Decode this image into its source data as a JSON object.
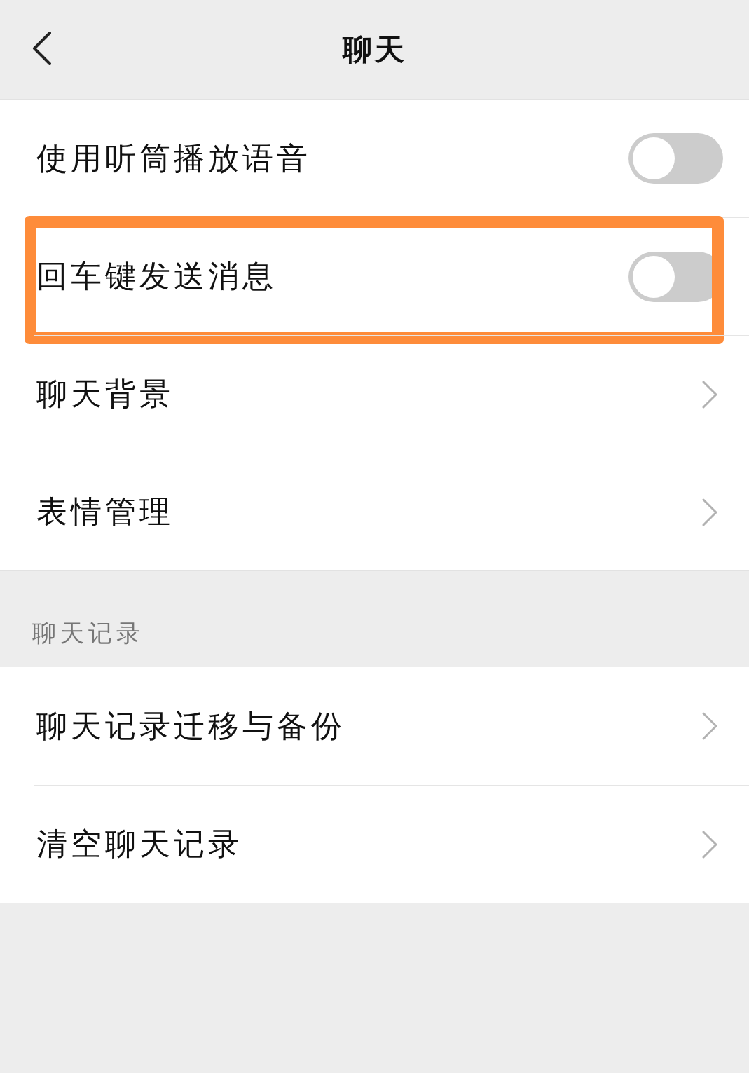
{
  "nav_bar": {
    "title": "聊天"
  },
  "groups": [
    {
      "items": [
        {
          "kind": "toggle",
          "label": "使用听筒播放语音",
          "on": false,
          "highlighted": false
        },
        {
          "kind": "toggle",
          "label": "回车键发送消息",
          "on": false,
          "highlighted": true
        },
        {
          "kind": "link",
          "label": "聊天背景",
          "highlighted": false
        },
        {
          "kind": "link",
          "label": "表情管理",
          "highlighted": false
        }
      ]
    },
    {
      "title": "聊天记录",
      "items": [
        {
          "kind": "link",
          "label": "聊天记录迁移与备份",
          "highlighted": false
        },
        {
          "kind": "link",
          "label": "清空聊天记录",
          "highlighted": false
        }
      ]
    }
  ]
}
